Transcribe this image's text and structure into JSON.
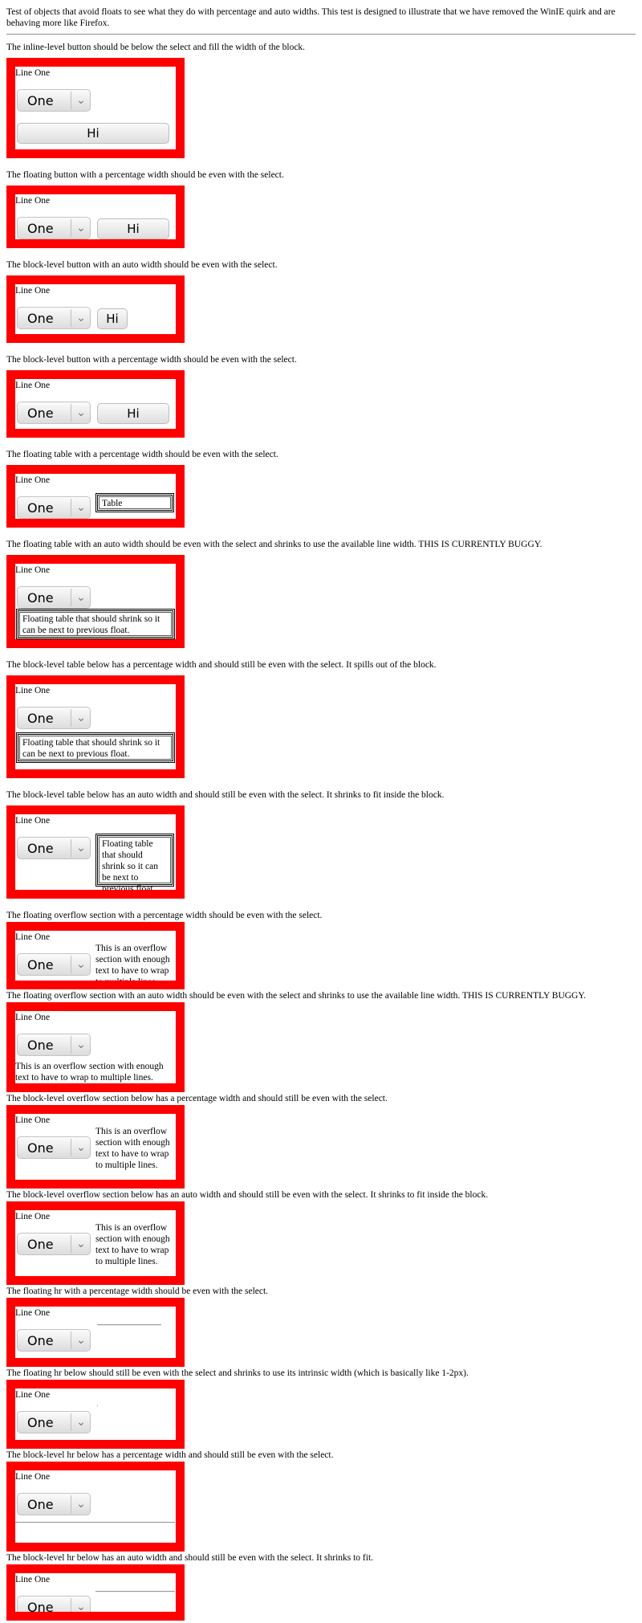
{
  "intro": "Test of objects that avoid floats to see what they do with percentage and auto widths. This test is designed to illustrate that we have removed the WinIE quirk and are behaving more like Firefox.",
  "line_one": "Line One",
  "select_value": "One",
  "button_label": "Hi",
  "table_short": "Table",
  "table_long": "Floating table that should shrink so it can be next to previous float.",
  "overflow_text": "This is an overflow section with enough text to have to wrap to multiple lines.",
  "sections": [
    {
      "desc": "The inline-level button should be below the select and fill the width of the block."
    },
    {
      "desc": "The floating button with a percentage width should be even with the select."
    },
    {
      "desc": "The block-level button with an auto width should be even with the select."
    },
    {
      "desc": "The block-level button with a percentage width should be even with the select."
    },
    {
      "desc": "The floating table with a percentage width should be even with the select."
    },
    {
      "desc": "The floating table with an auto width should be even with the select and shrinks to use the available line width. THIS IS CURRENTLY BUGGY."
    },
    {
      "desc": "The block-level table below has a percentage width and should still be even with the select. It spills out of the block."
    },
    {
      "desc": "The block-level table below has an auto width and should still be even with the select. It shrinks to fit inside the block."
    },
    {
      "desc": "The floating overflow section with a percentage width should be even with the select."
    },
    {
      "desc": "The floating overflow section with an auto width should be even with the select and shrinks to use the available line width. THIS IS CURRENTLY BUGGY."
    },
    {
      "desc": "The block-level overflow section below has a percentage width and should still be even with the select."
    },
    {
      "desc": "The block-level overflow section below has an auto width and should still be even with the select. It shrinks to fit inside the block."
    },
    {
      "desc": "The floating hr with a percentage width should be even with the select."
    },
    {
      "desc": "The floating hr below should still be even with the select and shrinks to use its intrinsic width (which is basically like 1-2px)."
    },
    {
      "desc": "The block-level hr below has a percentage width and should still be even with the select."
    },
    {
      "desc": "The block-level hr below has an auto width and should still be even with the select. It shrinks to fit."
    }
  ]
}
